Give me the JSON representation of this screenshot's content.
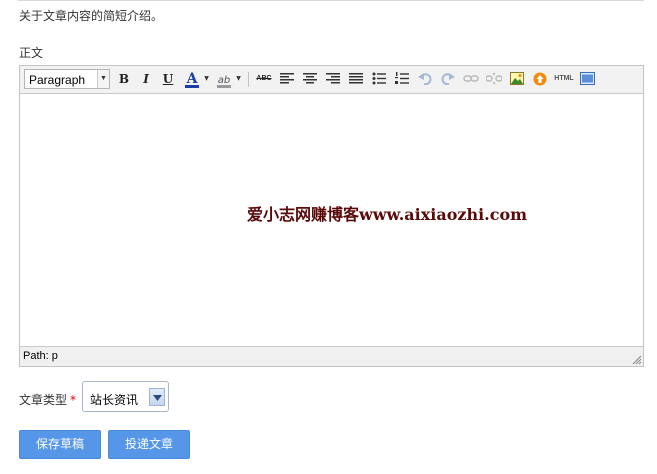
{
  "form": {
    "hint": "关于文章内容的简短介绍。",
    "body_label": "正文",
    "editor": {
      "format_select": "Paragraph",
      "watermark": "爱小志网赚博客www.aixiaozhi.com",
      "status_path": "Path: p",
      "html_button": "HTML",
      "font_color_letter": "A",
      "highlight_letters": "ab",
      "strike_letters": "ABC",
      "bold": "B",
      "italic": "I",
      "underline": "U"
    },
    "type_label": "文章类型",
    "required_mark": "*",
    "type_value": "站长资讯",
    "save_draft": "保存草稿",
    "submit": "投递文章"
  },
  "colors": {
    "button": "#5596e8",
    "font_color_bar": "#1a3ea3",
    "highlight_bar": "#999999",
    "watermark": "#5a0a0a",
    "required": "#dd0000"
  }
}
